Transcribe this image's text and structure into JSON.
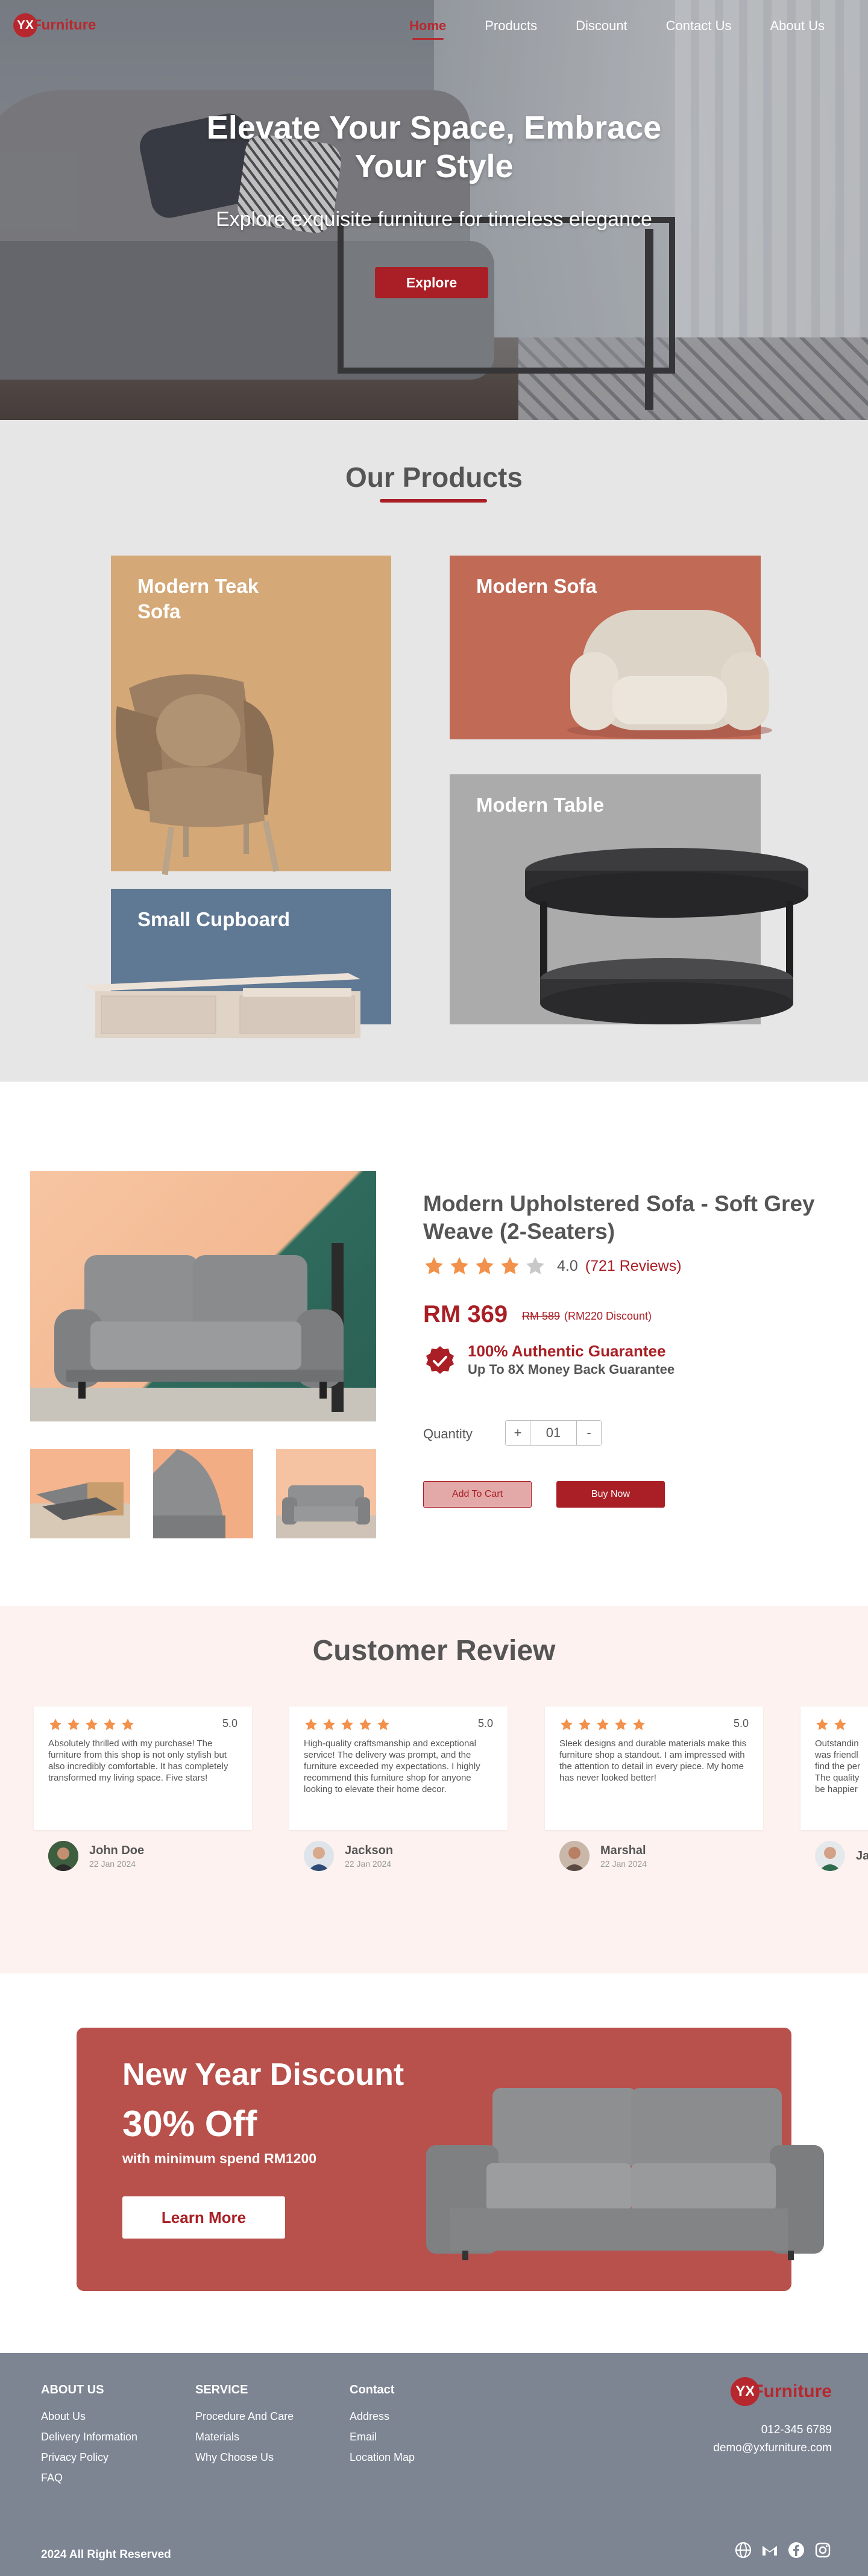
{
  "brand": {
    "mark": "YX",
    "name": "Furniture"
  },
  "nav": {
    "items": [
      {
        "label": "Home",
        "active": true
      },
      {
        "label": "Products",
        "active": false
      },
      {
        "label": "Discount",
        "active": false
      },
      {
        "label": "Contact Us",
        "active": false
      },
      {
        "label": "About Us",
        "active": false
      }
    ]
  },
  "hero": {
    "title": "Elevate Your Space, Embrace Your Style",
    "subtitle": "Explore exquisite furniture for timeless elegance",
    "cta": "Explore"
  },
  "products": {
    "title": "Our Products",
    "cards": [
      {
        "label": "Modern Teak Sofa"
      },
      {
        "label": "Modern Sofa"
      },
      {
        "label": "Modern Table"
      },
      {
        "label": "Small Cupboard"
      }
    ]
  },
  "detail": {
    "title": "Modern Upholstered Sofa - Soft Grey Weave (2-Seaters)",
    "rating": 4,
    "rating_text": "4.0",
    "reviews_text": "(721 Reviews)",
    "price": "RM 369",
    "old_price": "RM 589",
    "discount_text": "(RM220 Discount)",
    "guarantee_title": "100% Authentic Guarantee",
    "guarantee_sub": "Up To 8X Money Back Guarantee",
    "quantity_label": "Quantity",
    "quantity_value": "01",
    "plus": "+",
    "minus": "-",
    "add_to_cart": "Add To Cart",
    "buy_now": "Buy Now"
  },
  "reviews": {
    "title": "Customer Review",
    "items": [
      {
        "score": "5.0",
        "text": "Absolutely thrilled with my purchase! The furniture from this shop is not only stylish but also incredibly comfortable. It has completely transformed my living space. Five stars!",
        "name": "John Doe",
        "date": "22 Jan 2024"
      },
      {
        "score": "5.0",
        "text": "High-quality craftsmanship and exceptional service! The delivery was prompt, and the furniture exceeded my expectations. I highly recommend this furniture shop for anyone looking to elevate their home decor.",
        "name": "Jackson",
        "date": "22 Jan 2024"
      },
      {
        "score": "5.0",
        "text": "Sleek designs and durable materials make this furniture shop a standout. I am impressed with the attention to detail in every piece. My home has never looked better!",
        "name": "Marshal",
        "date": "22 Jan 2024"
      },
      {
        "score": "",
        "text": "Outstandin was friendl find the per The quality be happier",
        "name": "Ja",
        "date": ""
      }
    ]
  },
  "promo": {
    "title": "New Year Discount",
    "off": "30% Off",
    "min": "with minimum spend RM1200",
    "cta": "Learn More"
  },
  "footer": {
    "about": {
      "heading": "ABOUT US",
      "links": [
        "About Us",
        "Delivery Information",
        "Privacy Policy",
        "FAQ"
      ]
    },
    "service": {
      "heading": "SERVICE",
      "links": [
        "Procedure And Care",
        "Materials",
        "Why Choose Us"
      ]
    },
    "contact": {
      "heading": "Contact",
      "links": [
        "Address",
        "Email",
        "Location Map"
      ]
    },
    "phone": "012-345 6789",
    "email": "demo@yxfurniture.com",
    "copyright": "2024 All Right Reserved"
  },
  "colors": {
    "accent": "#a91f25",
    "hero_overlay": "#3a3a42",
    "footer_bg": "#7d8593",
    "review_bg": "#fdf2ef",
    "promo_bg": "#b8504b",
    "star": "#f2914b"
  }
}
